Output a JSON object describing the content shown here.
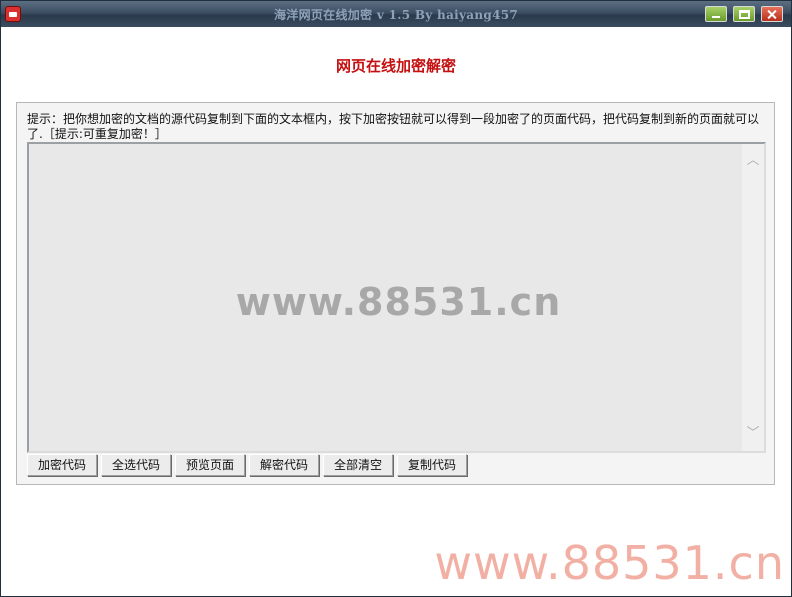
{
  "window": {
    "title": "海洋网页在线加密 v 1.5  By haiyang457",
    "controls": {
      "minimize": "minimize",
      "maximize": "maximize",
      "close": "close"
    }
  },
  "page": {
    "heading": "网页在线加密解密"
  },
  "panel": {
    "hint": "提示：把你想加密的文档的源代码复制到下面的文本框内，按下加密按钮就可以得到一段加密了的页面代码，把代码复制到新的页面就可以了.［提示:可重复加密！］",
    "textarea_value": "",
    "scroll_up_glyph": "︿",
    "scroll_down_glyph": "﹀"
  },
  "toolbar": {
    "buttons": [
      {
        "label": "加密代码"
      },
      {
        "label": "全选代码"
      },
      {
        "label": "预览页面"
      },
      {
        "label": "解密代码"
      },
      {
        "label": "全部清空"
      },
      {
        "label": "复制代码"
      }
    ]
  },
  "watermarks": {
    "center": "www.88531.cn",
    "corner": "www.88531.cn"
  },
  "colors": {
    "heading": "#c41010",
    "titlebar": "#3c4e62",
    "corner_watermark": "#f2b0a4"
  }
}
